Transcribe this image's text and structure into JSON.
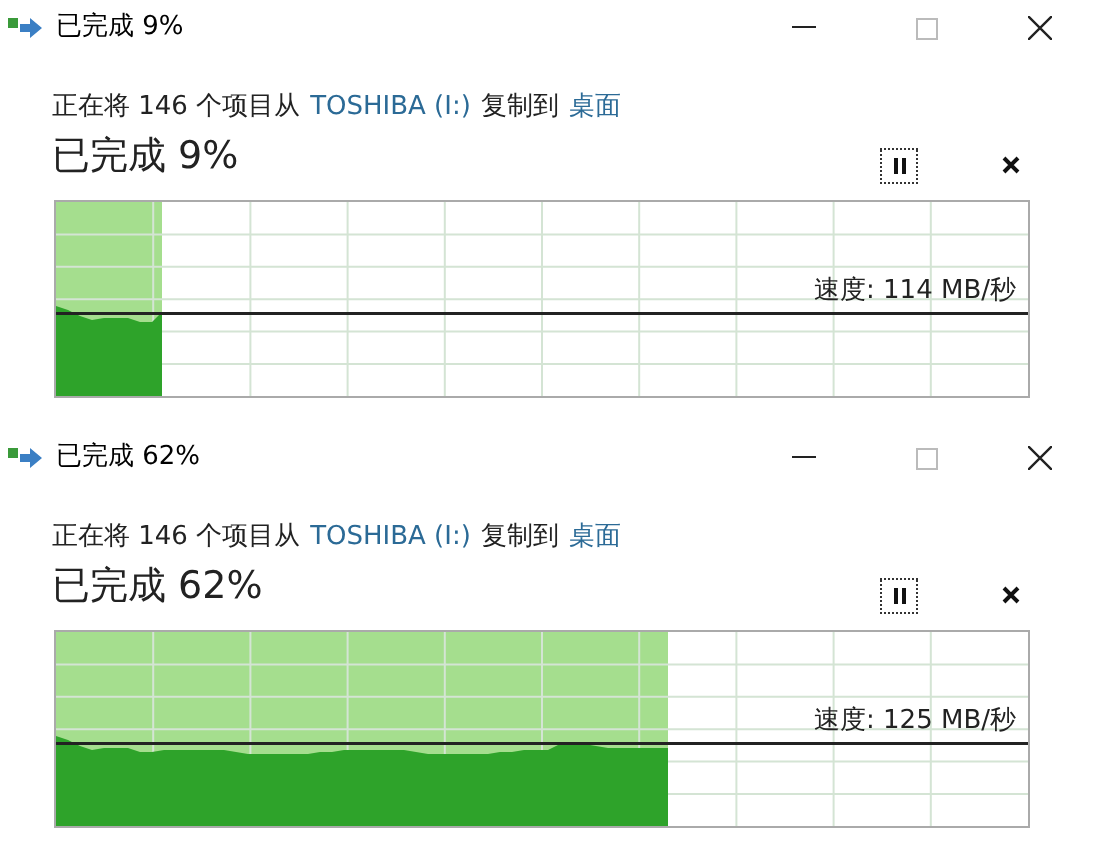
{
  "dialogs": [
    {
      "title": "已完成 9%",
      "description": [
        {
          "kind": "plain",
          "text": "正在将 146 个项目从"
        },
        {
          "kind": "link",
          "text": "TOSHIBA (I:)"
        },
        {
          "kind": "plain",
          "text": "复制到"
        },
        {
          "kind": "link",
          "text": "桌面"
        }
      ],
      "status": "已完成 9%",
      "speed": "速度: 114 MB/秒",
      "level": 0.11
    },
    {
      "title": "已完成 62%",
      "description": [
        {
          "kind": "plain",
          "text": "正在将 146 个项目从"
        },
        {
          "kind": "link",
          "text": "TOSHIBA (I:)"
        },
        {
          "kind": "plain",
          "text": "复制到"
        },
        {
          "kind": "link",
          "text": "桌面"
        }
      ],
      "status": "已完成 62%",
      "speed": "速度: 125 MB/秒",
      "level": 0.63
    }
  ]
}
